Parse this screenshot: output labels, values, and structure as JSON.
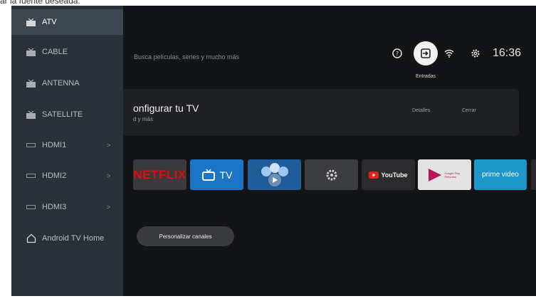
{
  "caption": "ar la fuente deseada.",
  "search": {
    "placeholder_text": "Busca películas, series y mucho más"
  },
  "status": {
    "inputs_label": "Entradas",
    "time": "16:36"
  },
  "setup_card": {
    "title": "onfigurar tu TV",
    "subtitle": "d y más",
    "details_label": "Detalles",
    "close_label": "Cerrar"
  },
  "apps": {
    "netflix_label": "NETFLIX",
    "tv_label": "TV",
    "youtube_label": "YouTube",
    "play_movies_label": "Google Play Películas",
    "prime_label": "prime video"
  },
  "customize_label": "Personalizar canales",
  "sidebar": {
    "items": [
      {
        "label": "ATV",
        "icon": "tv-icon"
      },
      {
        "label": "CABLE",
        "icon": "tv-icon"
      },
      {
        "label": "ANTENNA",
        "icon": "tv-icon"
      },
      {
        "label": "SATELLITE",
        "icon": "tv-icon"
      },
      {
        "label": "HDMI1",
        "icon": "hdmi-icon",
        "chevron": ">"
      },
      {
        "label": "HDMI2",
        "icon": "hdmi-icon",
        "chevron": ">"
      },
      {
        "label": "HDMI3",
        "icon": "hdmi-icon",
        "chevron": ">"
      },
      {
        "label": "Android TV Home",
        "icon": "home-icon"
      }
    ]
  },
  "colors": {
    "accent_selected": "#3e474f",
    "sidebar_bg": "#2a3138",
    "screen_bg": "#131416",
    "netflix_red": "#e50914"
  }
}
